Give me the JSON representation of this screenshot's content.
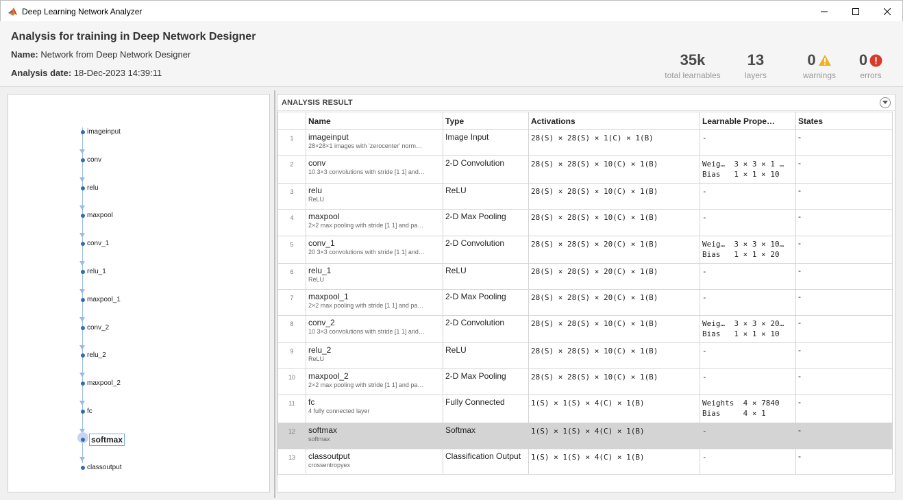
{
  "window": {
    "title": "Deep Learning Network Analyzer"
  },
  "header": {
    "title": "Analysis for training in Deep Network Designer",
    "name_label": "Name:",
    "name_value": "Network from Deep Network Designer",
    "date_label": "Analysis date:",
    "date_value": "18-Dec-2023 14:39:11",
    "stats": {
      "learnables": {
        "value": "35k",
        "label": "total learnables"
      },
      "layers": {
        "value": "13",
        "label": "layers"
      },
      "warnings": {
        "value": "0",
        "label": "warnings"
      },
      "errors": {
        "value": "0",
        "label": "errors"
      }
    }
  },
  "colors": {
    "accent": "#2f6db5",
    "warning": "#f2b01e",
    "error": "#d63b2c"
  },
  "graph": {
    "nodes": [
      "imageinput",
      "conv",
      "relu",
      "maxpool",
      "conv_1",
      "relu_1",
      "maxpool_1",
      "conv_2",
      "relu_2",
      "maxpool_2",
      "fc",
      "softmax",
      "classoutput"
    ],
    "selected": "softmax"
  },
  "result": {
    "title": "ANALYSIS RESULT",
    "columns": [
      "Name",
      "Type",
      "Activations",
      "Learnable Prope…",
      "States"
    ],
    "rows": [
      {
        "idx": "1",
        "name": "imageinput",
        "desc": "28×28×1 images with 'zerocenter' norm…",
        "type": "Image Input",
        "act": "28(S) × 28(S) × 1(C) × 1(B)",
        "learn1": "-",
        "learn2": "",
        "states": "-"
      },
      {
        "idx": "2",
        "name": "conv",
        "desc": "10 3×3 convolutions with stride [1 1] and…",
        "type": "2-D Convolution",
        "act": "28(S) × 28(S) × 10(C) × 1(B)",
        "learn1": "Weig…  3 × 3 × 1 …",
        "learn2": "Bias   1 × 1 × 10",
        "states": "-"
      },
      {
        "idx": "3",
        "name": "relu",
        "desc": "ReLU",
        "type": "ReLU",
        "act": "28(S) × 28(S) × 10(C) × 1(B)",
        "learn1": "-",
        "learn2": "",
        "states": "-"
      },
      {
        "idx": "4",
        "name": "maxpool",
        "desc": "2×2 max pooling with stride [1 1] and pa…",
        "type": "2-D Max Pooling",
        "act": "28(S) × 28(S) × 10(C) × 1(B)",
        "learn1": "-",
        "learn2": "",
        "states": "-"
      },
      {
        "idx": "5",
        "name": "conv_1",
        "desc": "20 3×3 convolutions with stride [1 1] and…",
        "type": "2-D Convolution",
        "act": "28(S) × 28(S) × 20(C) × 1(B)",
        "learn1": "Weig…  3 × 3 × 10…",
        "learn2": "Bias   1 × 1 × 20",
        "states": "-"
      },
      {
        "idx": "6",
        "name": "relu_1",
        "desc": "ReLU",
        "type": "ReLU",
        "act": "28(S) × 28(S) × 20(C) × 1(B)",
        "learn1": "-",
        "learn2": "",
        "states": "-"
      },
      {
        "idx": "7",
        "name": "maxpool_1",
        "desc": "2×2 max pooling with stride [1 1] and pa…",
        "type": "2-D Max Pooling",
        "act": "28(S) × 28(S) × 20(C) × 1(B)",
        "learn1": "-",
        "learn2": "",
        "states": "-"
      },
      {
        "idx": "8",
        "name": "conv_2",
        "desc": "10 3×3 convolutions with stride [1 1] and…",
        "type": "2-D Convolution",
        "act": "28(S) × 28(S) × 10(C) × 1(B)",
        "learn1": "Weig…  3 × 3 × 20…",
        "learn2": "Bias   1 × 1 × 10",
        "states": "-"
      },
      {
        "idx": "9",
        "name": "relu_2",
        "desc": "ReLU",
        "type": "ReLU",
        "act": "28(S) × 28(S) × 10(C) × 1(B)",
        "learn1": "-",
        "learn2": "",
        "states": "-"
      },
      {
        "idx": "10",
        "name": "maxpool_2",
        "desc": "2×2 max pooling with stride [1 1] and pa…",
        "type": "2-D Max Pooling",
        "act": "28(S) × 28(S) × 10(C) × 1(B)",
        "learn1": "-",
        "learn2": "",
        "states": "-"
      },
      {
        "idx": "11",
        "name": "fc",
        "desc": "4 fully connected layer",
        "type": "Fully Connected",
        "act": "1(S) × 1(S) × 4(C) × 1(B)",
        "learn1": "Weights  4 × 7840",
        "learn2": "Bias     4 × 1",
        "states": "-"
      },
      {
        "idx": "12",
        "name": "softmax",
        "desc": "softmax",
        "type": "Softmax",
        "act": "1(S) × 1(S) × 4(C) × 1(B)",
        "learn1": "-",
        "learn2": "",
        "states": "-"
      },
      {
        "idx": "13",
        "name": "classoutput",
        "desc": "crossentropyex",
        "type": "Classification Output",
        "act": "1(S) × 1(S) × 4(C) × 1(B)",
        "learn1": "-",
        "learn2": "",
        "states": "-"
      }
    ],
    "selected_idx": "12"
  }
}
